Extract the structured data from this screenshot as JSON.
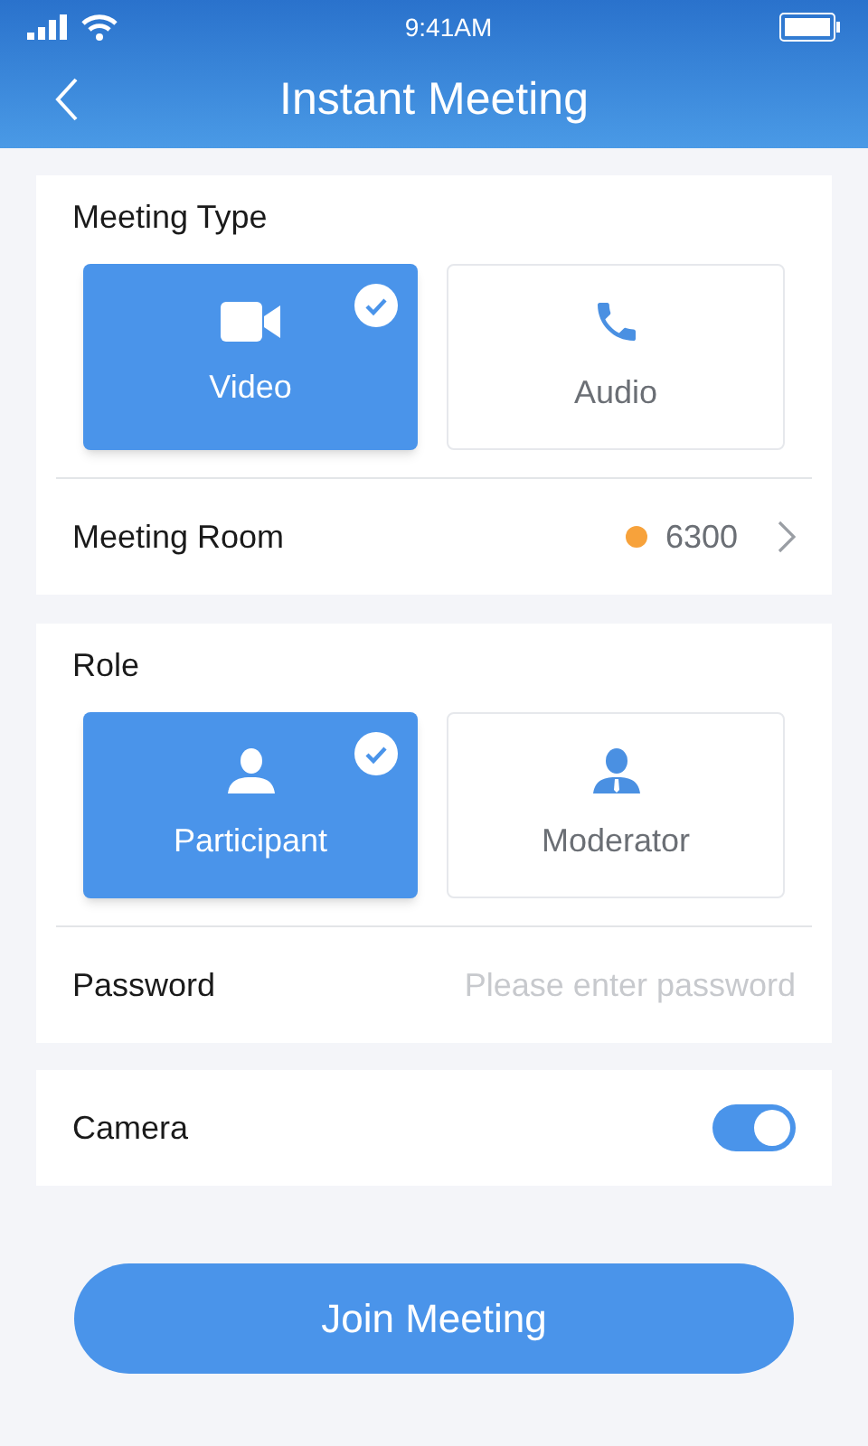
{
  "status_bar": {
    "time": "9:41AM"
  },
  "header": {
    "title": "Instant Meeting"
  },
  "meeting_type": {
    "title": "Meeting Type",
    "options": [
      {
        "label": "Video",
        "kind": "video",
        "selected": true
      },
      {
        "label": "Audio",
        "kind": "phone",
        "selected": false
      }
    ],
    "room": {
      "label": "Meeting Room",
      "value": "6300",
      "color": "#f7a23b"
    }
  },
  "role": {
    "title": "Role",
    "options": [
      {
        "label": "Participant",
        "kind": "person",
        "selected": true
      },
      {
        "label": "Moderator",
        "kind": "moderator",
        "selected": false
      }
    ],
    "password": {
      "label": "Password",
      "placeholder": "Please enter password"
    }
  },
  "camera": {
    "label": "Camera",
    "on": true
  },
  "join_button": "Join Meeting"
}
